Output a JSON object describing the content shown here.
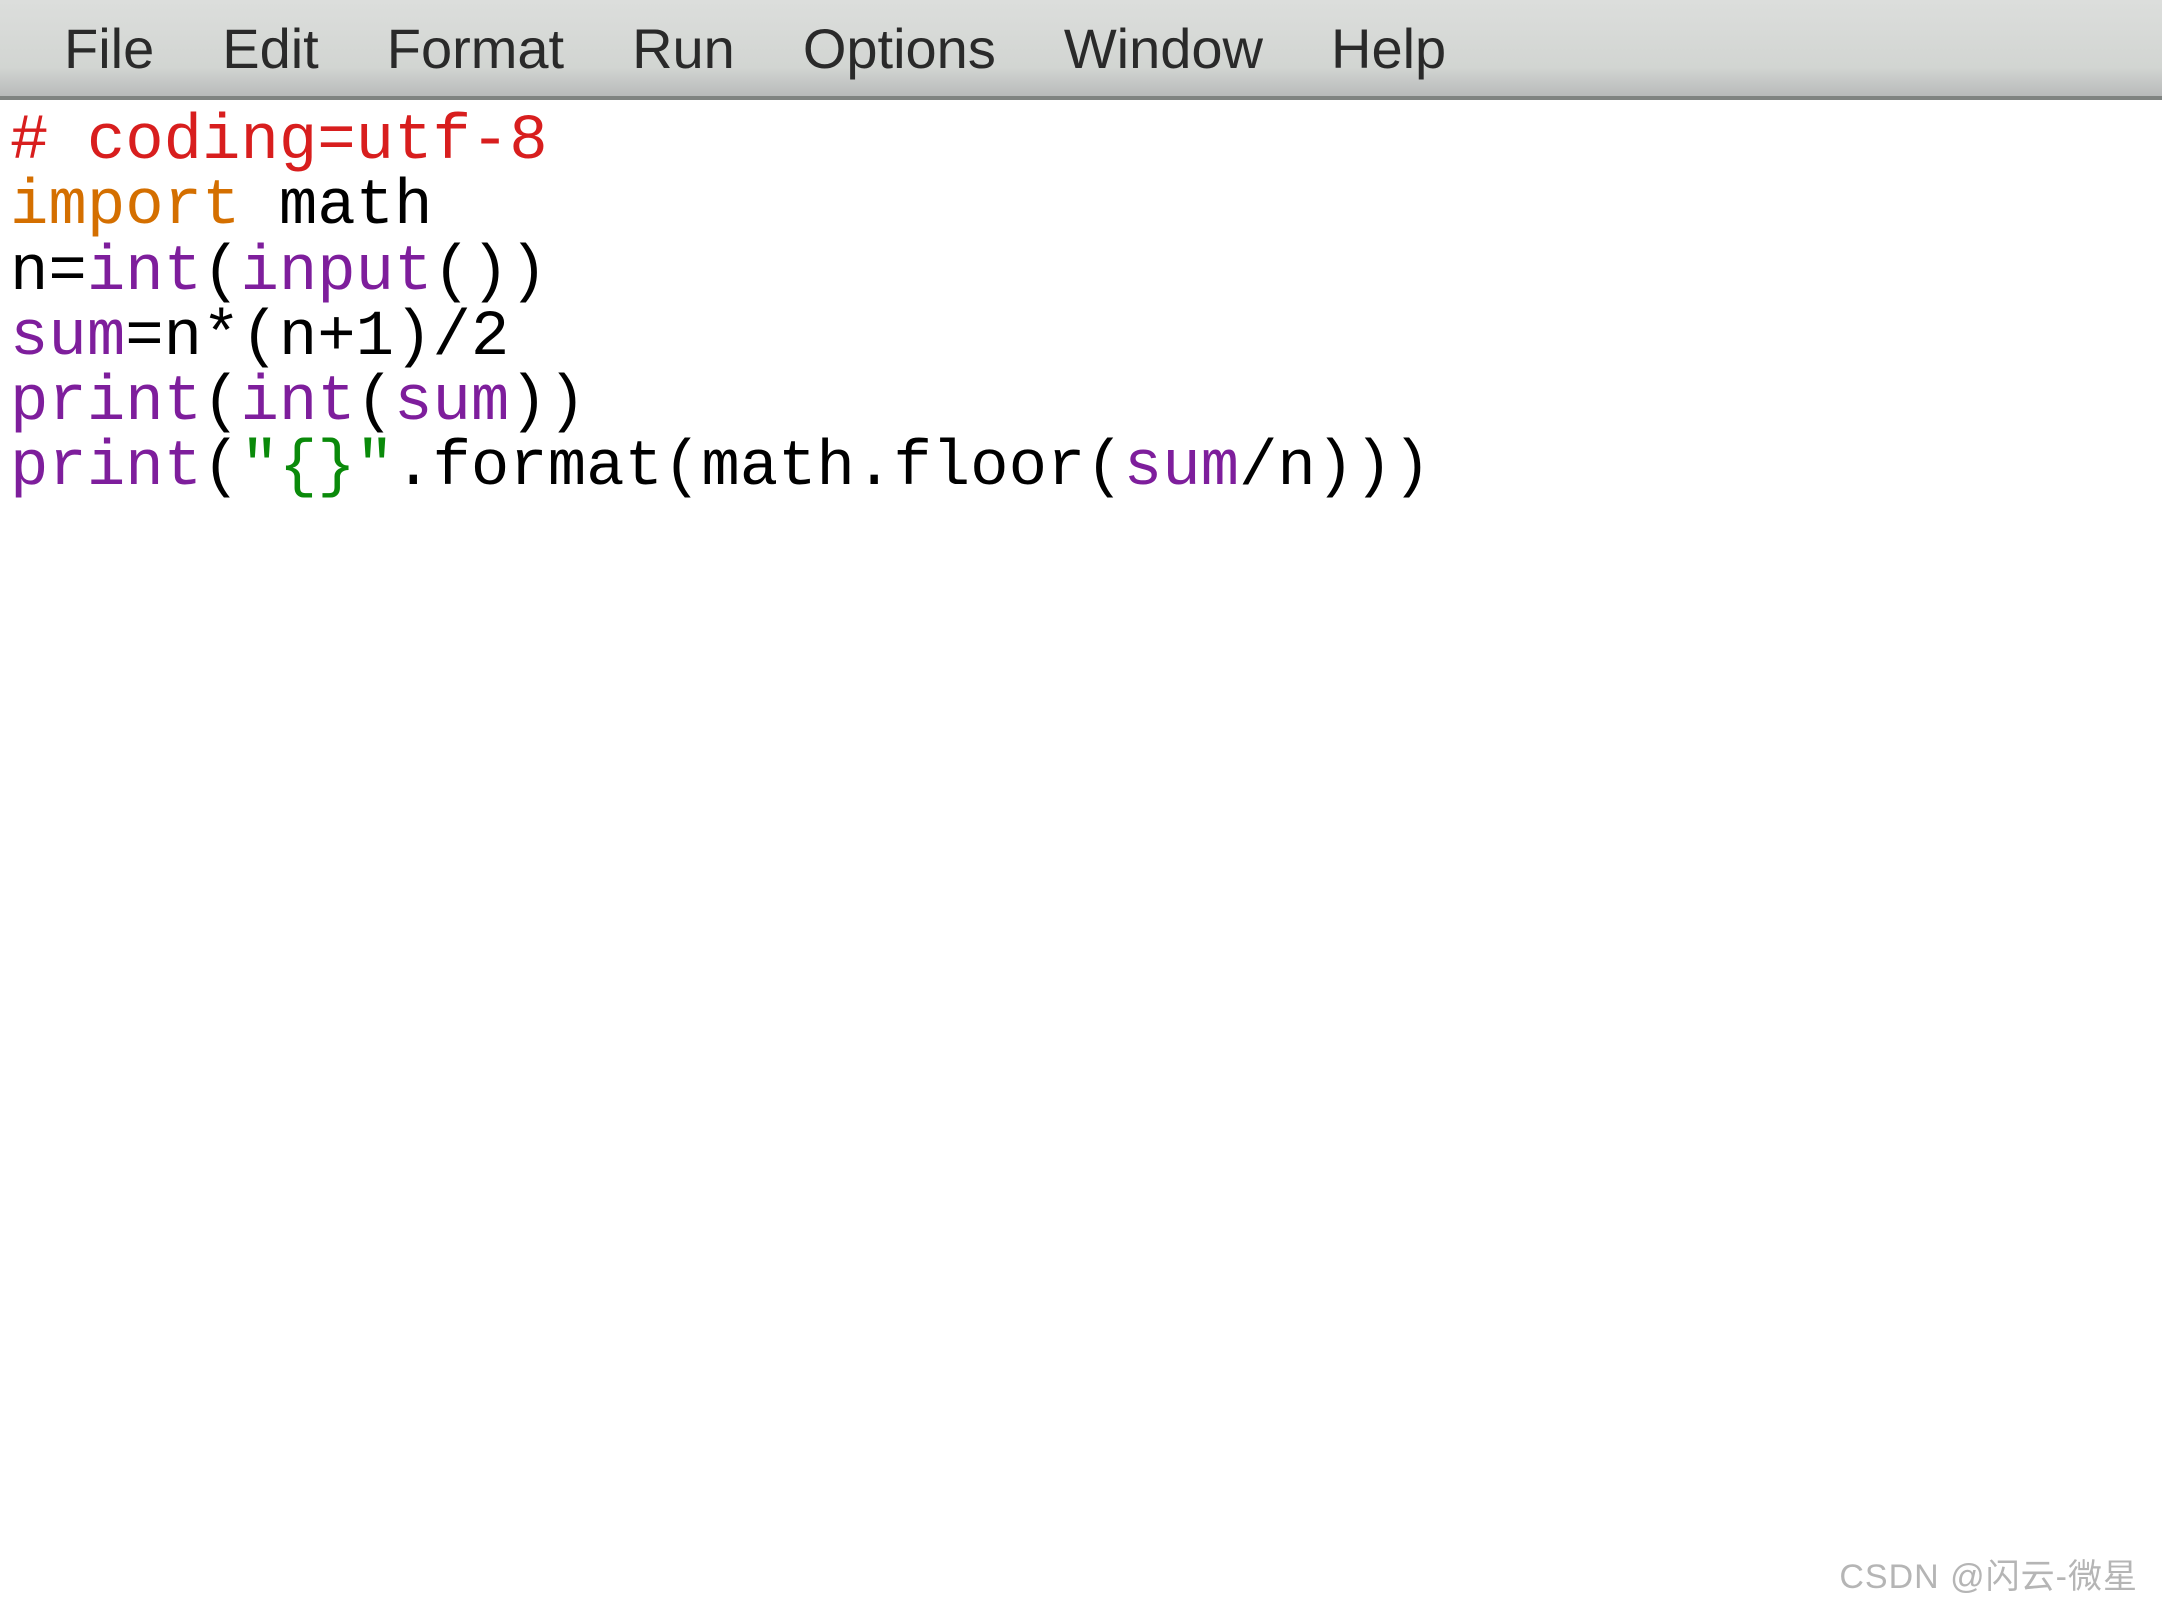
{
  "menu": {
    "items": [
      "File",
      "Edit",
      "Format",
      "Run",
      "Options",
      "Window",
      "Help"
    ]
  },
  "code": {
    "l1_comment": "# coding=utf-8",
    "l2_kw": "import",
    "l2_mod": " math",
    "l3_a": "n=",
    "l3_int": "int",
    "l3_b": "(",
    "l3_input": "input",
    "l3_c": "())",
    "l4_a": "sum",
    "l4_b": "=n*(n+1)/2",
    "l5_print": "print",
    "l5_a": "(",
    "l5_int": "int",
    "l5_b": "(",
    "l5_sum": "sum",
    "l5_c": "))",
    "l6_print": "print",
    "l6_a": "(",
    "l6_str": "\"{}\"",
    "l6_b": ".format(math.floor(",
    "l6_sum": "sum",
    "l6_c": "/n)))"
  },
  "watermark": "CSDN @闪云-微星"
}
